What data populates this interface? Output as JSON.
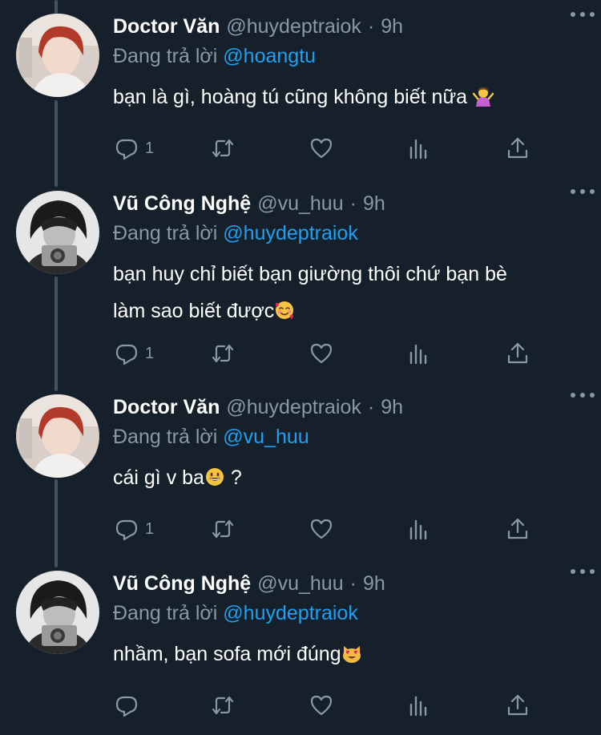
{
  "tweets": [
    {
      "name": "Doctor Văn",
      "handle": "@huydeptraiok",
      "dot": "·",
      "time": "9h",
      "reply_prefix": "Đang trả lời",
      "reply_to": "@hoangtu",
      "text": "bạn là gì, hoàng tú cũng không biết nữa",
      "emoji": "person-shrugging-emoji",
      "reply_count": "1",
      "avatar": "red-hair-person-avatar"
    },
    {
      "name": "Vũ Công Nghệ",
      "handle": "@vu_huu",
      "dot": "·",
      "time": "9h",
      "reply_prefix": "Đang trả lời",
      "reply_to": "@huydeptraiok",
      "text_line1": "bạn huy chỉ biết bạn giường thôi chứ bạn bè",
      "text_line2": "làm sao biết được",
      "emoji": "smiling-face-with-hearts-emoji",
      "reply_count": "1",
      "avatar": "camera-person-avatar"
    },
    {
      "name": "Doctor Văn",
      "handle": "@huydeptraiok",
      "dot": "·",
      "time": "9h",
      "reply_prefix": "Đang trả lời",
      "reply_to": "@vu_huu",
      "text": "cái gì v ba",
      "text_after": " ?",
      "emoji": "grinning-face-emoji",
      "reply_count": "1",
      "avatar": "red-hair-person-avatar"
    },
    {
      "name": "Vũ Công Nghệ",
      "handle": "@vu_huu",
      "dot": "·",
      "time": "9h",
      "reply_prefix": "Đang trả lời",
      "reply_to": "@huydeptraiok",
      "text": "nhầm, bạn sofa mới đúng",
      "emoji": "heart-eyes-cat-emoji",
      "reply_count": "",
      "avatar": "camera-person-avatar"
    }
  ],
  "colors": {
    "background": "#15202b",
    "secondary_text": "#8899a6",
    "mention": "#1da1f2",
    "thread_line": "#3d5466"
  },
  "icons": [
    "reply-icon",
    "retweet-icon",
    "like-icon",
    "analytics-icon",
    "share-icon",
    "more-icon"
  ]
}
